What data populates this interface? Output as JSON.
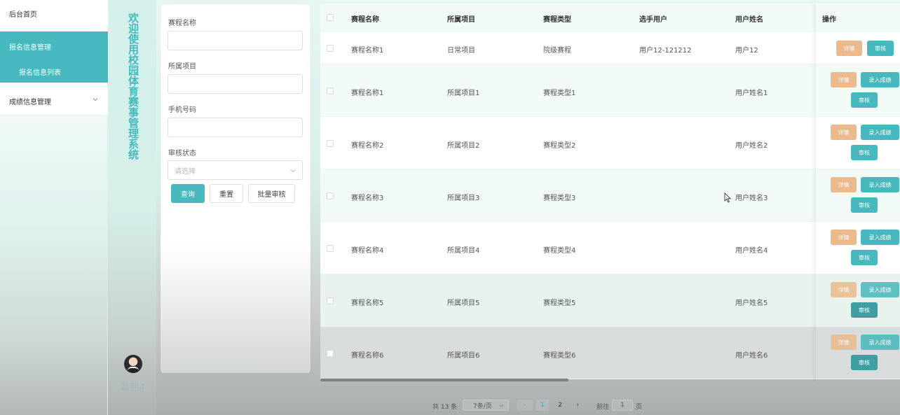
{
  "sidebar": {
    "home": "后台首页",
    "signup_group": "报名信息管理",
    "signup_list": "报名信息列表",
    "score_group": "成绩信息管理"
  },
  "banner": {
    "title": "欢迎使用校园体育赛事管理系统",
    "username": "裁判4"
  },
  "search": {
    "event_name_label": "赛程名称",
    "project_label": "所属项目",
    "phone_label": "手机号码",
    "status_label": "审核状态",
    "status_placeholder": "请选择",
    "query_button": "查询",
    "reset_button": "重置",
    "batch_review_button": "批量审核"
  },
  "table": {
    "headers": [
      "赛程名称",
      "所属项目",
      "赛程类型",
      "选手用户",
      "用户姓名",
      "操作"
    ],
    "rows": [
      {
        "name": "赛程名称1",
        "project": "日常项目",
        "type": "院级赛程",
        "user": "用户12-121212",
        "username": "用户12",
        "actions": [
          "详情",
          "审核"
        ]
      },
      {
        "name": "赛程名称1",
        "project": "所属项目1",
        "type": "赛程类型1",
        "user": "",
        "username": "用户姓名1",
        "actions": [
          "详情",
          "录入成绩",
          "审核"
        ]
      },
      {
        "name": "赛程名称2",
        "project": "所属项目2",
        "type": "赛程类型2",
        "user": "",
        "username": "用户姓名2",
        "actions": [
          "详情",
          "录入成绩",
          "审核"
        ]
      },
      {
        "name": "赛程名称3",
        "project": "所属项目3",
        "type": "赛程类型3",
        "user": "",
        "username": "用户姓名3",
        "actions": [
          "详情",
          "录入成绩",
          "审核"
        ]
      },
      {
        "name": "赛程名称4",
        "project": "所属项目4",
        "type": "赛程类型4",
        "user": "",
        "username": "用户姓名4",
        "actions": [
          "详情",
          "录入成绩",
          "审核"
        ]
      },
      {
        "name": "赛程名称5",
        "project": "所属项目5",
        "type": "赛程类型5",
        "user": "",
        "username": "用户姓名5",
        "actions": [
          "详情",
          "录入成绩",
          "审核"
        ]
      },
      {
        "name": "赛程名称6",
        "project": "所属项目6",
        "type": "赛程类型6",
        "user": "",
        "username": "用户姓名6",
        "actions": [
          "详情",
          "录入成绩",
          "审核"
        ]
      }
    ]
  },
  "pagination": {
    "total": "共 13 条",
    "page_size": "7条/页",
    "prev": "‹",
    "page1": "1",
    "page2": "2",
    "next": "›",
    "goto_label": "前往",
    "goto_value": "1",
    "page_suffix": "页"
  },
  "colors": {
    "accent": "#47b8bd",
    "detail_button": "#ebb98b",
    "header_bg": "#f1fbf6"
  }
}
